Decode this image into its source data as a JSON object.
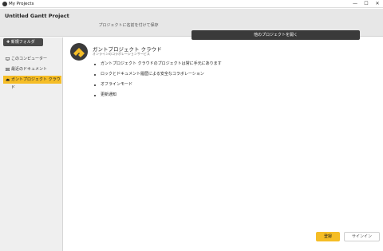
{
  "window": {
    "title": "My Projects",
    "controls": {
      "minimize": "—",
      "maximize": "☐",
      "close": "✕"
    }
  },
  "header": {
    "project_title": "Untitled Gantt Project",
    "save_as_link": "プロジェクトに名前を付けて保存",
    "open_other_button": "他のプロジェクトを開く"
  },
  "sidebar": {
    "new_button": "✚ 新規フォルダ",
    "items": [
      {
        "label": "このコンピューター",
        "icon": "monitor-icon",
        "active": false
      },
      {
        "label": "最近のドキュメント",
        "icon": "clock-icon",
        "active": false
      },
      {
        "label": "ガントプロジェクト クラウド",
        "icon": "cloud-icon",
        "active": true
      }
    ]
  },
  "main": {
    "title": "ガントプロジェクト クラウド",
    "subtitle": "オンラインのコラボレーションサービス",
    "features": [
      "ガントプロジェクト クラウドのプロジェクトは常に手元にあります",
      "ロックとドキュメント履歴による安全なコラボレーション",
      "オフラインモード",
      "更新通知"
    ],
    "register_button": "登録",
    "signin_button": "サインイン"
  },
  "colors": {
    "accent": "#f5bd26",
    "dark_button": "#3a3a3a",
    "header_bg": "#e7e7e7",
    "sidebar_bg": "#efefef"
  }
}
